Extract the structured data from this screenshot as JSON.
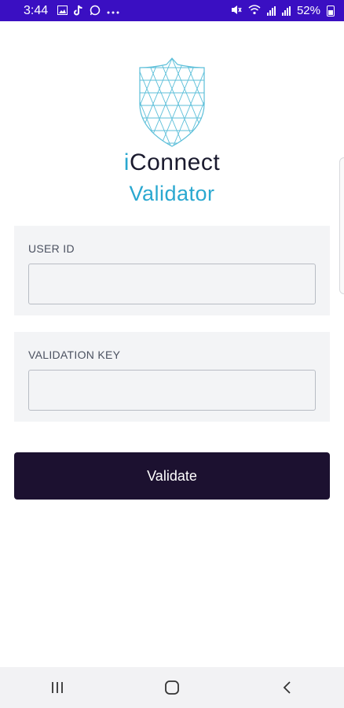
{
  "status_bar": {
    "time": "3:44",
    "battery": "52%",
    "icons_left": [
      "gallery-icon",
      "tiktok-icon",
      "whatsapp-icon",
      "more-dots-icon"
    ],
    "icons_right": [
      "mute-icon",
      "wifi-icon",
      "signal-icon",
      "battery-icon"
    ]
  },
  "brand": {
    "title_accent": "i",
    "title_rest": "Connect",
    "subtitle": "Validator"
  },
  "form": {
    "user_id_label": "USER ID",
    "user_id_value": "",
    "validation_key_label": "VALIDATION KEY",
    "validation_key_value": ""
  },
  "actions": {
    "validate_label": "Validate"
  },
  "colors": {
    "status_bar": "#3a0fc2",
    "accent": "#2aa8d0",
    "button": "#1c1130",
    "panel": "#f3f4f6"
  }
}
